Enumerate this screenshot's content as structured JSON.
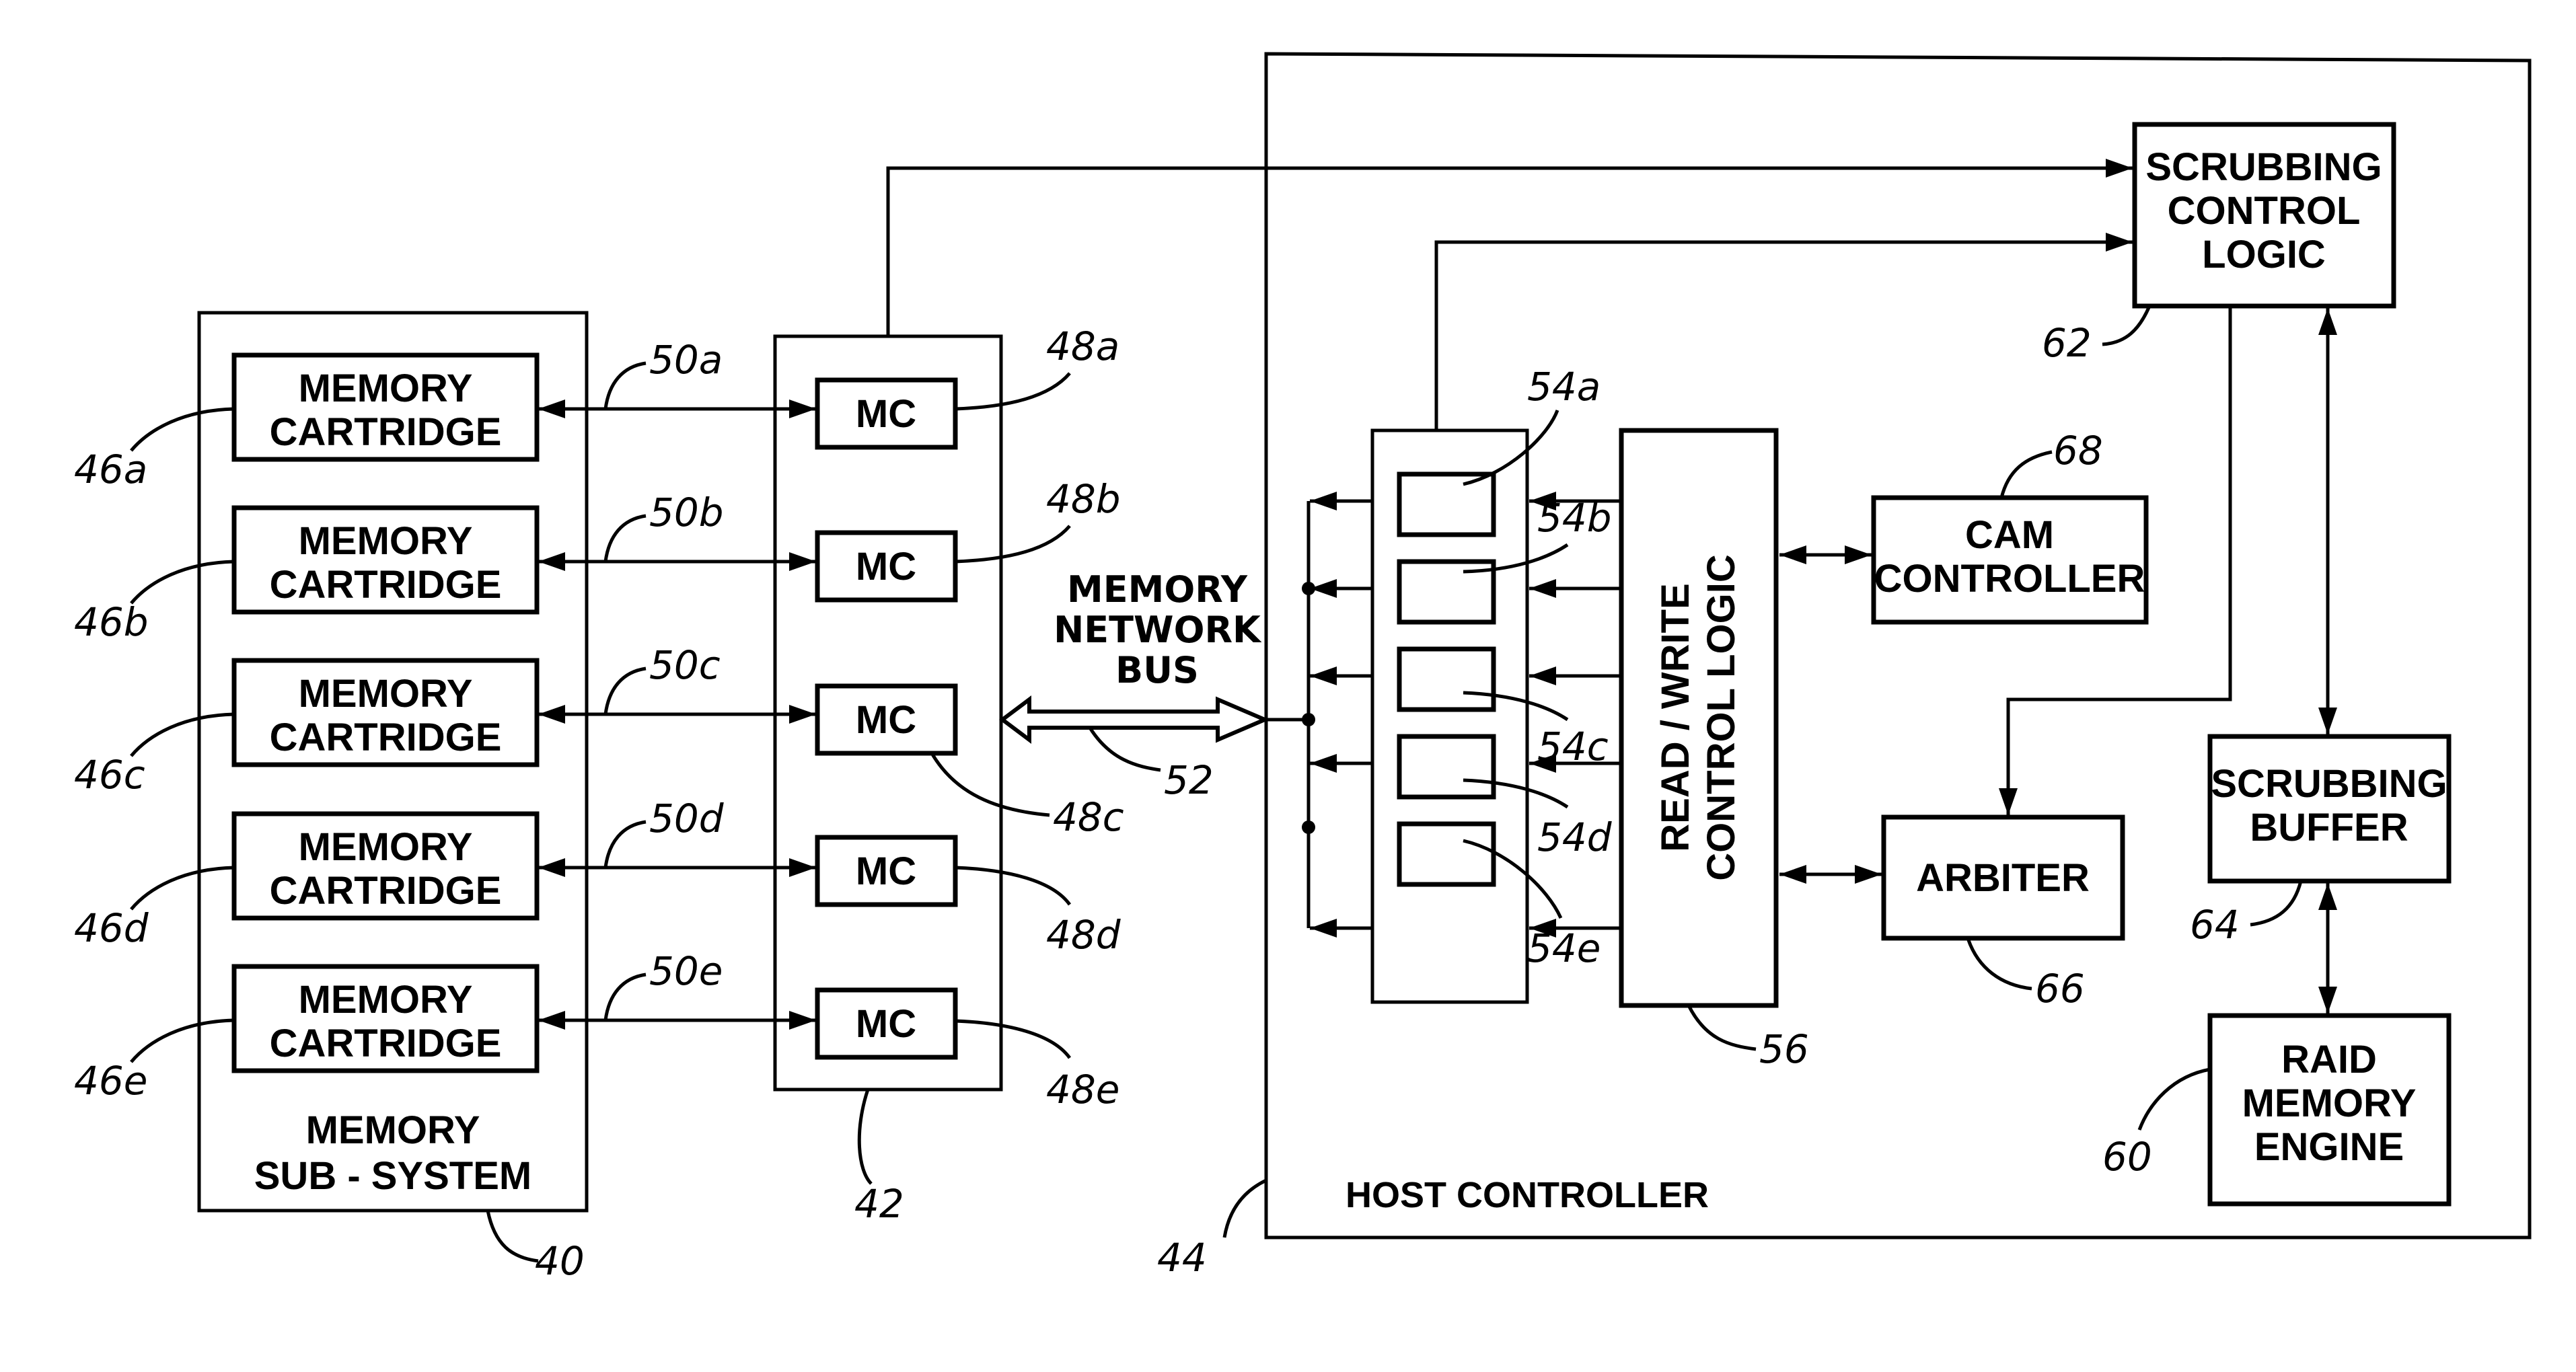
{
  "diagram": {
    "memory_subsystem": {
      "label_line1": "MEMORY",
      "label_line2": "SUB - SYSTEM",
      "ref": "40",
      "cartridges": [
        {
          "line1": "MEMORY",
          "line2": "CARTRIDGE",
          "ref": "46a",
          "link_ref": "50a"
        },
        {
          "line1": "MEMORY",
          "line2": "CARTRIDGE",
          "ref": "46b",
          "link_ref": "50b"
        },
        {
          "line1": "MEMORY",
          "line2": "CARTRIDGE",
          "ref": "46c",
          "link_ref": "50c"
        },
        {
          "line1": "MEMORY",
          "line2": "CARTRIDGE",
          "ref": "46d",
          "link_ref": "50d"
        },
        {
          "line1": "MEMORY",
          "line2": "CARTRIDGE",
          "ref": "46e",
          "link_ref": "50e"
        }
      ]
    },
    "mc_group": {
      "ref": "42",
      "controllers": [
        {
          "label": "MC",
          "ref": "48a"
        },
        {
          "label": "MC",
          "ref": "48b"
        },
        {
          "label": "MC",
          "ref": "48c"
        },
        {
          "label": "MC",
          "ref": "48d"
        },
        {
          "label": "MC",
          "ref": "48e"
        }
      ]
    },
    "bus": {
      "line1": "MEMORY",
      "line2": "NETWORK",
      "line3": "BUS",
      "ref": "52"
    },
    "host_controller": {
      "label": "HOST CONTROLLER",
      "ref": "44",
      "registers": [
        {
          "ref": "54a"
        },
        {
          "ref": "54b"
        },
        {
          "ref": "54c"
        },
        {
          "ref": "54d"
        },
        {
          "ref": "54e"
        }
      ],
      "rw_logic": {
        "line1": "READ / WRITE",
        "line2": "CONTROL LOGIC",
        "ref": "56"
      },
      "cam_controller": {
        "line1": "CAM",
        "line2": "CONTROLLER",
        "ref": "68"
      },
      "arbiter": {
        "label": "ARBITER",
        "ref": "66"
      },
      "scrubbing_control": {
        "line1": "SCRUBBING",
        "line2": "CONTROL",
        "line3": "LOGIC",
        "ref": "62"
      },
      "scrubbing_buffer": {
        "line1": "SCRUBBING",
        "line2": "BUFFER",
        "ref": "64"
      },
      "raid_engine": {
        "line1": "RAID",
        "line2": "MEMORY",
        "line3": "ENGINE",
        "ref": "60"
      }
    }
  }
}
